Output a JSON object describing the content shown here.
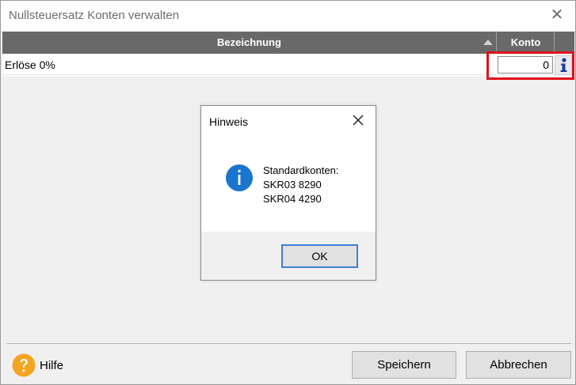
{
  "window": {
    "title": "Nullsteuersatz Konten verwalten",
    "close_glyph": "✕"
  },
  "grid": {
    "columns": [
      "Bezeichnung",
      "Konto"
    ],
    "rows": [
      {
        "bezeichnung": "Erlöse 0%",
        "konto": "0"
      }
    ]
  },
  "dialog": {
    "title": "Hinweis",
    "message_lines": [
      "Standardkonten:",
      "SKR03 8290",
      "SKR04 4290"
    ],
    "ok_label": "OK"
  },
  "footer": {
    "help_label": "Hilfe",
    "save_label": "Speichern",
    "cancel_label": "Abbrechen"
  },
  "colors": {
    "header_bg": "#696969",
    "highlight": "#e0101c",
    "info_blue": "#1a75cf",
    "help_orange": "#f3a420"
  }
}
